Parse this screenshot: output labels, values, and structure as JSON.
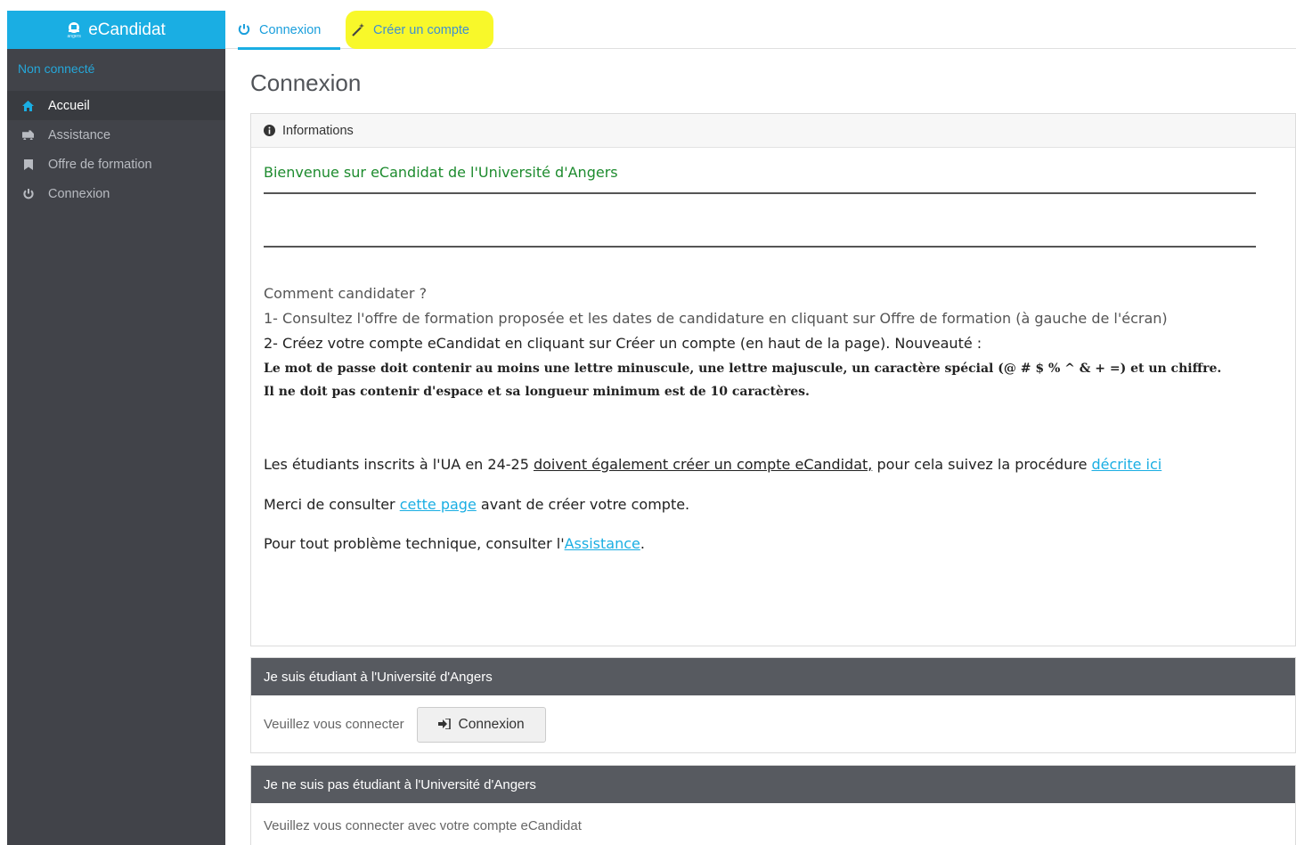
{
  "app": {
    "title": "eCandidat",
    "logo_caption": "angers"
  },
  "sidebar": {
    "status": "Non connecté",
    "items": [
      {
        "label": "Accueil",
        "icon": "home-icon",
        "active": true
      },
      {
        "label": "Assistance",
        "icon": "ambulance-icon",
        "active": false
      },
      {
        "label": "Offre de formation",
        "icon": "bookmark-icon",
        "active": false
      },
      {
        "label": "Connexion",
        "icon": "power-icon",
        "active": false
      }
    ]
  },
  "tabs": [
    {
      "label": "Connexion",
      "icon": "power-icon",
      "active": true
    },
    {
      "label": "Créer un compte",
      "icon": "magic-wand-icon",
      "highlighted": true
    }
  ],
  "page": {
    "title": "Connexion"
  },
  "info_panel": {
    "header": "Informations",
    "welcome": "Bienvenue sur eCandidat de l'Université d'Angers",
    "how_title": "Comment candidater ?",
    "step1": "1- Consultez l'offre de formation proposée et les dates de candidature en cliquant sur Offre de formation (à gauche de l'écran)",
    "step2": "2- Créez votre compte eCandidat en cliquant sur Créer un compte (en haut de la page). Nouveauté :",
    "password_rule1": "Le mot de passe doit contenir au moins une lettre minuscule, une lettre majuscule, un caractère spécial (@ # $ % ^ & + =) et un chiffre.",
    "password_rule2": "Il ne doit pas contenir d'espace et sa longueur minimum est de 10 caractères.",
    "students_prefix": "Les étudiants inscrits à l'UA en 24-25 ",
    "students_underlined": "doivent également créer un compte eCandidat,",
    "students_middle": " pour cela suivez la procédure ",
    "students_link": "décrite ici",
    "consult_prefix": "Merci de consulter ",
    "consult_link": "cette page",
    "consult_suffix": " avant de créer votre compte.",
    "tech_prefix": "Pour tout problème technique, consulter l'",
    "tech_link": "Assistance",
    "tech_suffix": "."
  },
  "student_panel": {
    "header": "Je suis étudiant à l'Université d'Angers",
    "prompt": "Veuillez vous connecter",
    "button": "Connexion"
  },
  "nonstudent_panel": {
    "header": "Je ne suis pas étudiant à l'Université d'Angers",
    "prompt": "Veuillez vous connecter avec votre compte eCandidat"
  },
  "colors": {
    "accent": "#1aaee3",
    "sidebar": "#414349",
    "highlight": "#f8f82a",
    "welcome": "#1d8b2e"
  }
}
